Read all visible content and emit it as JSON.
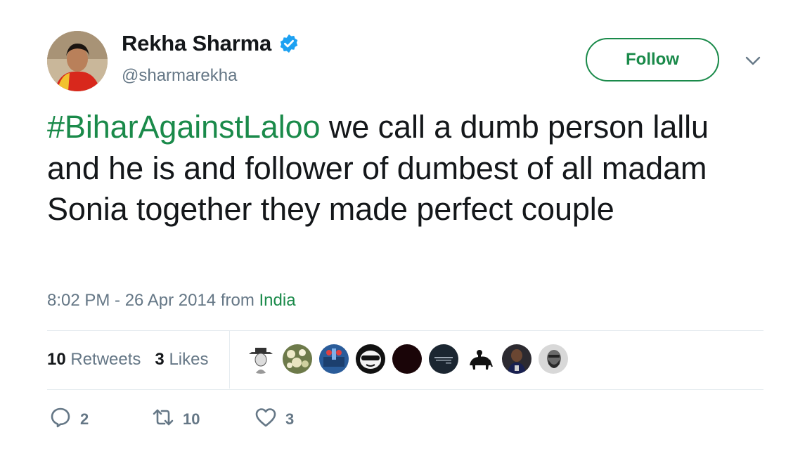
{
  "user": {
    "display_name": "Rekha Sharma",
    "handle": "@sharmarekha",
    "verified": true
  },
  "follow_label": "Follow",
  "tweet": {
    "hashtag": "#BiharAgainstLaloo",
    "text": " we call a dumb person lallu and he is and follower of dumbest of all madam Sonia together they made perfect couple"
  },
  "meta": {
    "timestamp": "8:02 PM - 26 Apr 2014",
    "from_label": "from",
    "place": "India"
  },
  "stats": {
    "retweets_count": "10",
    "retweets_label": "Retweets",
    "likes_count": "3",
    "likes_label": "Likes"
  },
  "actions": {
    "reply_count": "2",
    "retweet_count": "10",
    "like_count": "3"
  },
  "colors": {
    "accent": "#1a8a4a",
    "muted": "#657786",
    "text": "#14171a",
    "verified_badge": "#1da1f2"
  }
}
